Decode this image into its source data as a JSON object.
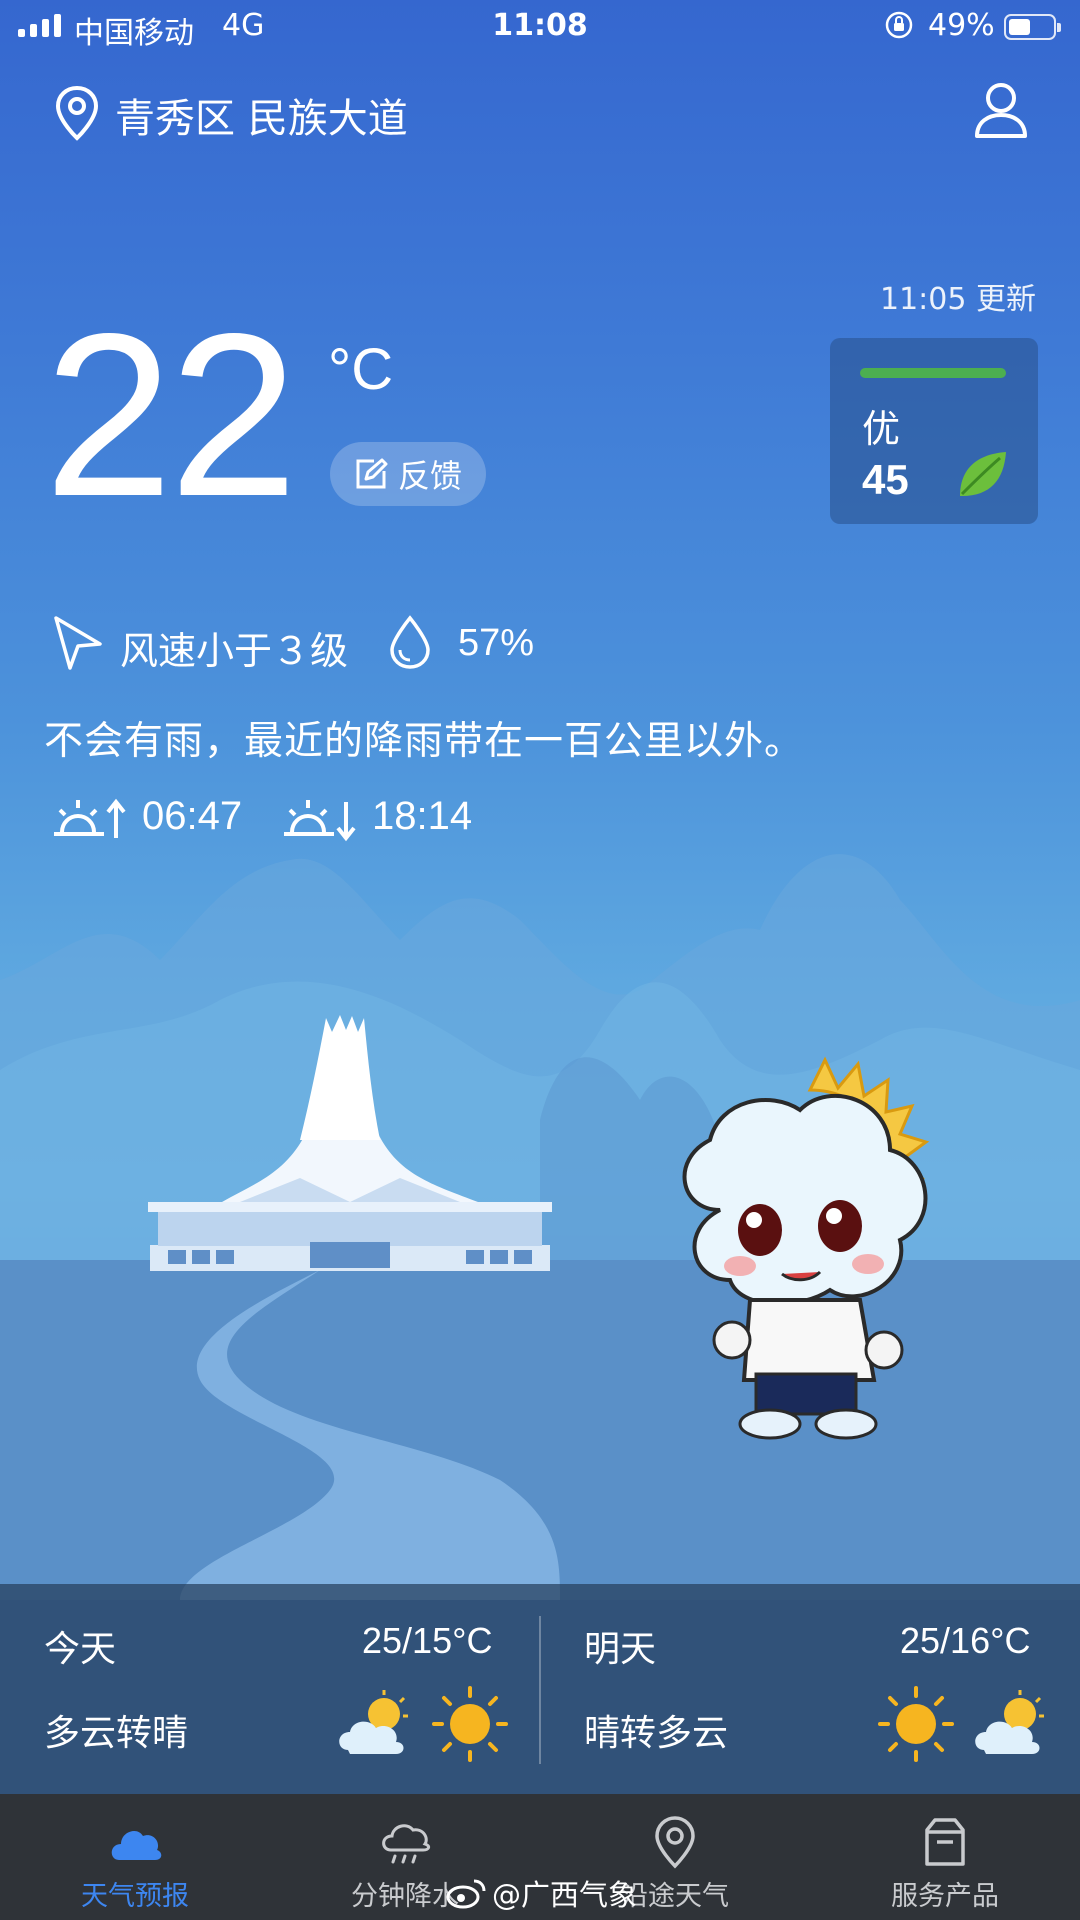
{
  "status_bar": {
    "carrier": "中国移动",
    "network": "4G",
    "time": "11:08",
    "battery_percent": "49%",
    "battery_level": 0.49
  },
  "header": {
    "location": "青秀区 民族大道",
    "location_icon": "location-pin-icon",
    "profile_icon": "user-icon"
  },
  "current": {
    "updated": "11:05 更新",
    "temperature": "22",
    "unit": "°C",
    "feedback_label": "反馈",
    "aqi_level": "优",
    "aqi_value": "45",
    "aqi_color": "#4caf50",
    "wind": "风速小于３级",
    "humidity": "57%",
    "description": "不会有雨，最近的降雨带在一百公里以外。",
    "sunrise": "06:47",
    "sunset": "18:14"
  },
  "forecast": {
    "today": {
      "day": "今天",
      "temp": "25/15°C",
      "condition": "多云转晴",
      "icons": [
        "partly-cloudy-icon",
        "sun-icon"
      ]
    },
    "tomorrow": {
      "day": "明天",
      "temp": "25/16°C",
      "condition": "晴转多云",
      "icons": [
        "sun-icon",
        "partly-cloudy-icon"
      ]
    }
  },
  "nav": {
    "items": [
      {
        "label": "天气预报",
        "icon": "cloud-icon",
        "active": true
      },
      {
        "label": "分钟降水",
        "icon": "rain-cloud-icon",
        "active": false
      },
      {
        "label": "沿途天气",
        "icon": "location-pin-icon",
        "active": false
      },
      {
        "label": "服务产品",
        "icon": "box-icon",
        "active": false
      }
    ],
    "active_color": "#3d86f0"
  },
  "watermark": "@广西气象"
}
